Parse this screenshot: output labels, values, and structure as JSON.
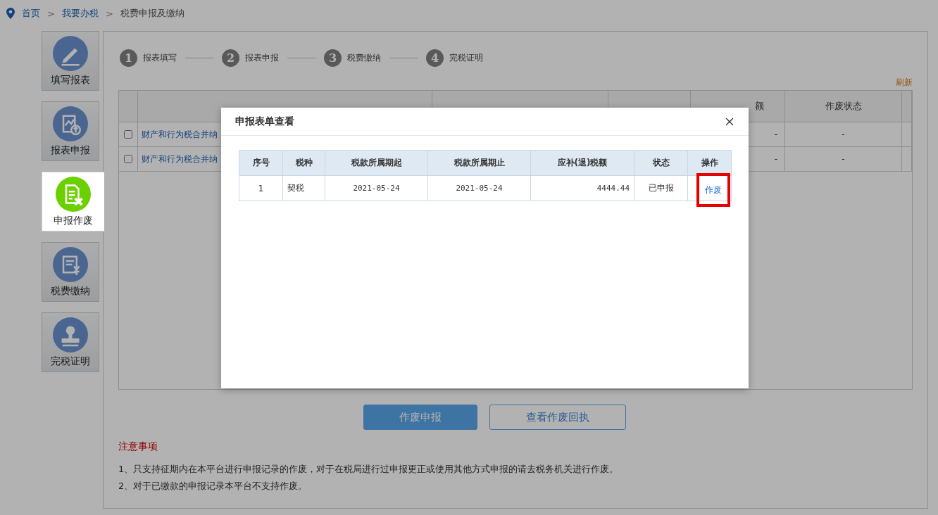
{
  "breadcrumb": [
    {
      "label": "首页",
      "kind": "link"
    },
    {
      "label": "我要办税",
      "kind": "link"
    },
    {
      "label": "税费申报及缴纳",
      "kind": "current"
    }
  ],
  "breadcrumb_separator": ">",
  "sidebar": {
    "items": [
      {
        "label": "填写报表",
        "selected": false
      },
      {
        "label": "报表申报",
        "selected": false
      },
      {
        "label": "申报作废",
        "selected": true
      },
      {
        "label": "税费缴纳",
        "selected": false
      },
      {
        "label": "完税证明",
        "selected": false
      }
    ]
  },
  "steps": [
    {
      "number": "1",
      "label": "报表填写"
    },
    {
      "number": "2",
      "label": "报表申报"
    },
    {
      "number": "3",
      "label": "税费缴纳"
    },
    {
      "number": "4",
      "label": "完税证明"
    }
  ],
  "refresh_link": "刷新",
  "table": {
    "columns": [
      {
        "label": "额",
        "kind": "partial"
      },
      {
        "label": "作废状态",
        "kind": "full"
      }
    ],
    "rows": [
      {
        "checked": false,
        "type": "财产和行为税合并纳",
        "amount": "-",
        "void_status": "-"
      },
      {
        "checked": false,
        "type": "财产和行为税合并纳",
        "amount": "-",
        "void_status": "-"
      }
    ]
  },
  "buttons": [
    {
      "label": "作废申报",
      "kind": "primary"
    },
    {
      "label": "查看作废回执",
      "kind": "outline"
    }
  ],
  "notes": {
    "title": "注意事项",
    "items": [
      "1、只支持征期内在本平台进行申报记录的作废，对于在税局进行过申报更正或使用其他方式申报的请去税务机关进行作废。",
      "2、对于已缴款的申报记录本平台不支持作废。"
    ]
  },
  "modal": {
    "title": "申报表单查看",
    "columns": [
      "序号",
      "税种",
      "税款所属期起",
      "税款所属期止",
      "应补(退)税额",
      "状态",
      "操作"
    ],
    "rows": [
      {
        "seq": "1",
        "tax": "契税",
        "start": "2021-05-24",
        "end": "2021-05-24",
        "amount": "4444.44",
        "status": "已申报",
        "action": "作废",
        "highlighted": true
      }
    ]
  }
}
